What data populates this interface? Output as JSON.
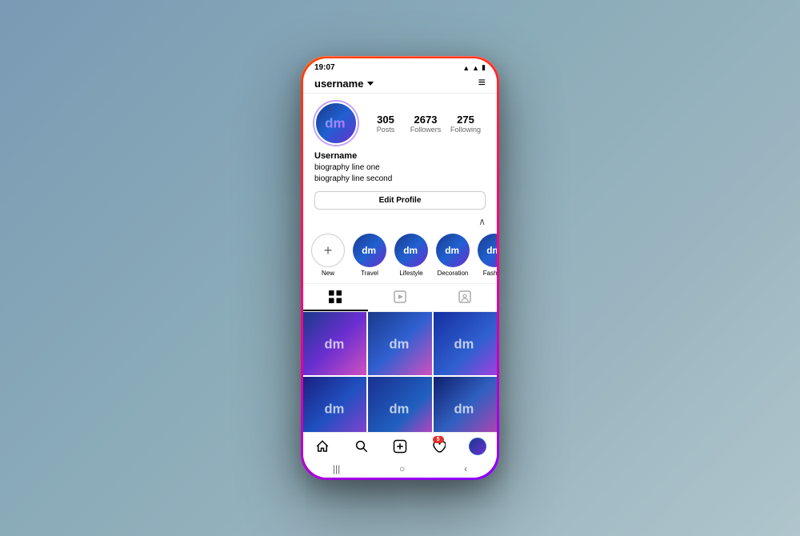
{
  "phone": {
    "status": {
      "time": "19:07"
    },
    "header": {
      "username": "username",
      "chevron": "▾",
      "menu_icon": "≡"
    },
    "profile": {
      "name": "Username",
      "bio_line1": "biography line one",
      "bio_line2": "biography line second",
      "stats": [
        {
          "number": "305",
          "label": "Posts"
        },
        {
          "number": "2673",
          "label": "Followers"
        },
        {
          "number": "275",
          "label": "Following"
        }
      ],
      "edit_profile_label": "Edit Profile"
    },
    "highlights": [
      {
        "label": "New",
        "type": "new"
      },
      {
        "label": "Travel",
        "type": "filled"
      },
      {
        "label": "Lifestyle",
        "type": "filled"
      },
      {
        "label": "Decoration",
        "type": "filled"
      },
      {
        "label": "Fashion",
        "type": "filled"
      }
    ],
    "tabs": [
      {
        "icon": "⊞",
        "label": "grid",
        "active": true
      },
      {
        "icon": "▷",
        "label": "reels",
        "active": false
      },
      {
        "icon": "◫",
        "label": "tagged",
        "active": false
      }
    ],
    "posts": [
      {
        "id": 1,
        "class": "post-1"
      },
      {
        "id": 2,
        "class": "post-2"
      },
      {
        "id": 3,
        "class": "post-3"
      },
      {
        "id": 4,
        "class": "post-4"
      },
      {
        "id": 5,
        "class": "post-5"
      },
      {
        "id": 6,
        "class": "post-6"
      }
    ],
    "bottom_nav": {
      "notification_count": "5",
      "items": [
        "home",
        "search",
        "add",
        "heart",
        "profile"
      ]
    },
    "android_nav": {
      "items": [
        "|||",
        "○",
        "‹"
      ]
    }
  }
}
